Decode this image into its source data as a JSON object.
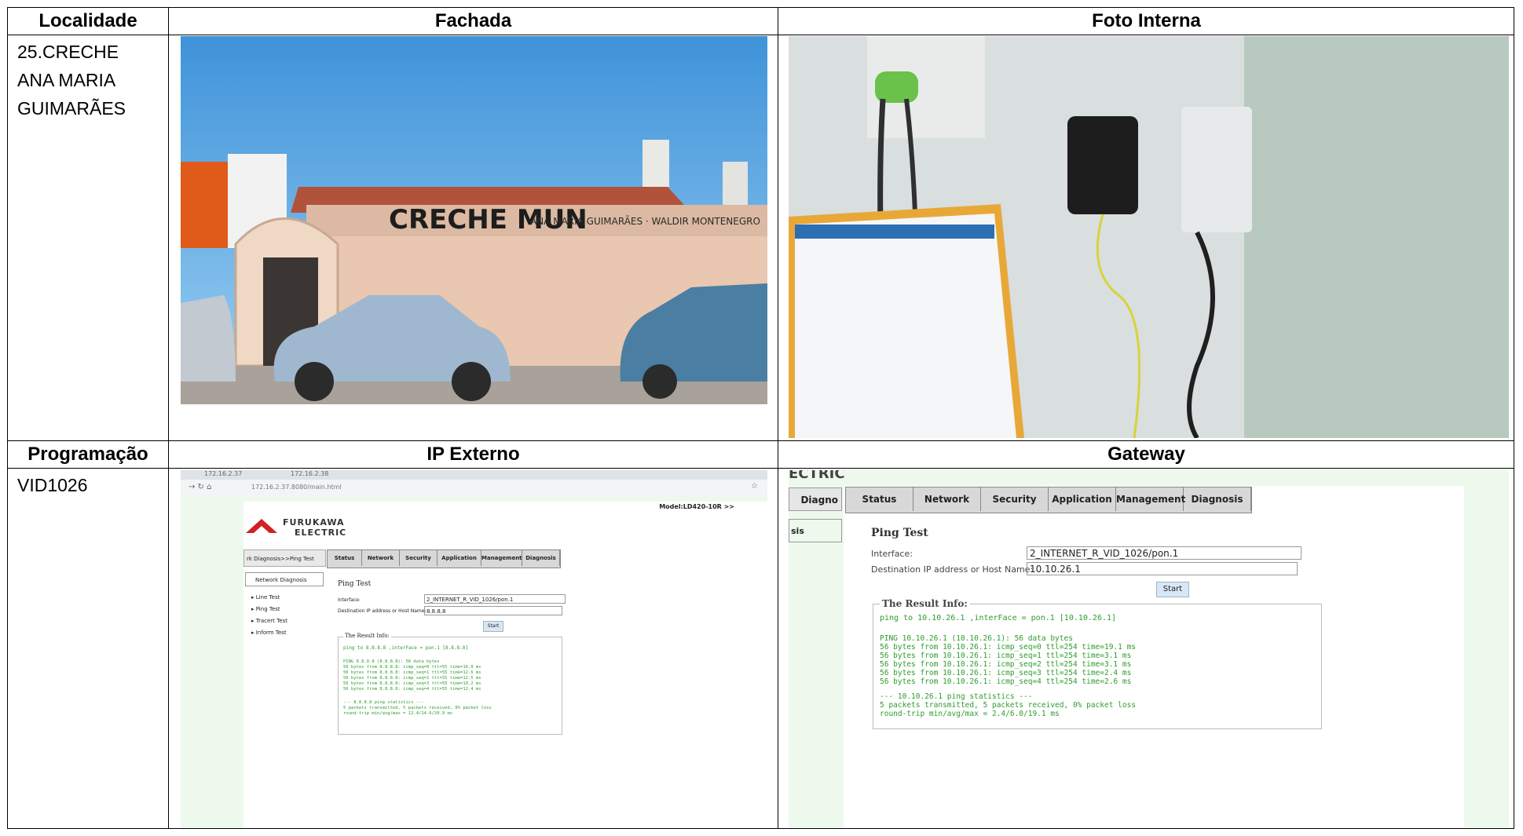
{
  "headers": {
    "localidade": "Localidade",
    "fachada": "Fachada",
    "foto_interna": "Foto Interna",
    "programacao": "Programação",
    "ip_externo": "IP Externo",
    "gateway": "Gateway"
  },
  "localidade_value": "25.CRECHE\nANA MARIA\nGUIMARÃES",
  "programacao_value": "VID1026",
  "fachada_photo": {
    "sign_text": "CRECHE MUN",
    "sign_small": "ANA MARIA GUIMARÃES · WALDIR MONTENEGRO"
  },
  "ip_externo_screenshot": {
    "tab1": "172.16.2.37",
    "tab2": "172.16.2.38",
    "url": "172.16.2.37.8080/main.html",
    "model": "Model:LD420-10R >>",
    "brand_line1": "FURUKAWA",
    "brand_line2": "ELECTRIC",
    "breadcrumb": "rk Diagnosis>>Ping Test",
    "tabs": [
      "Status",
      "Network",
      "Security",
      "Application",
      "Management",
      "Diagnosis"
    ],
    "side_title": "Network Diagnosis",
    "side_items": [
      "Line Test",
      "Ping Test",
      "Tracert Test",
      "Inform Test"
    ],
    "section_title": "Ping Test",
    "interface_label": "Interface:",
    "interface_value": "2_INTERNET_R_VID_1026/pon.1",
    "dest_label": "Destination IP address or Host Name:",
    "dest_value": "8.8.8.8",
    "start": "Start",
    "result_title": "The Result Info:",
    "result_head": "ping to 8.8.8.8 ,interFace = pon.1 [8.8.8.8]",
    "result_lines": [
      "PING 8.8.8.8 (8.8.8.8): 56 data bytes",
      "56 bytes from 8.8.8.8: icmp_seq=0 ttl=55 time=16.0 ms",
      "56 bytes from 8.8.8.8: icmp_seq=1 ttl=55 time=12.6 ms",
      "56 bytes from 8.8.8.8: icmp_seq=2 ttl=55 time=12.5 ms",
      "56 bytes from 8.8.8.8: icmp_seq=3 ttl=55 time=19.2 ms",
      "56 bytes from 8.8.8.8: icmp_seq=4 ttl=55 time=12.4 ms"
    ],
    "result_stats": [
      "--- 8.8.8.8 ping statistics ---",
      "5 packets transmitted, 5 packets received, 0% packet loss",
      "round-trip min/avg/max = 12.4/14.6/20.9 ms"
    ]
  },
  "gateway_screenshot": {
    "brand_partial": "ECTRIC",
    "side_tab": "Diagno",
    "side_item": "sis",
    "tabs": [
      "Status",
      "Network",
      "Security",
      "Application",
      "Management",
      "Diagnosis"
    ],
    "section_title": "Ping Test",
    "interface_label": "Interface:",
    "interface_value": "2_INTERNET_R_VID_1026/pon.1",
    "dest_label": "Destination IP address or Host Name:",
    "dest_value": "10.10.26.1",
    "start": "Start",
    "result_title": "The Result Info:",
    "result_head": "ping to 10.10.26.1 ,interFace = pon.1 [10.10.26.1]",
    "result_lines": [
      "PING 10.10.26.1 (10.10.26.1): 56 data bytes",
      "56 bytes from 10.10.26.1: icmp_seq=0 ttl=254 time=19.1 ms",
      "56 bytes from 10.10.26.1: icmp_seq=1 ttl=254 time=3.1 ms",
      "56 bytes from 10.10.26.1: icmp_seq=2 ttl=254 time=3.1 ms",
      "56 bytes from 10.10.26.1: icmp_seq=3 ttl=254 time=2.4 ms",
      "56 bytes from 10.10.26.1: icmp_seq=4 ttl=254 time=2.6 ms"
    ],
    "result_stats": [
      "--- 10.10.26.1 ping statistics ---",
      "5 packets transmitted, 5 packets received, 0% packet loss",
      "round-trip min/avg/max = 2.4/6.0/19.1 ms"
    ]
  },
  "colors": {
    "border": "#000000",
    "result_green": "#2e9c2e",
    "sky": "#5aa8e6",
    "wall": "#e8c8b2",
    "brand_red": "#d32020"
  }
}
